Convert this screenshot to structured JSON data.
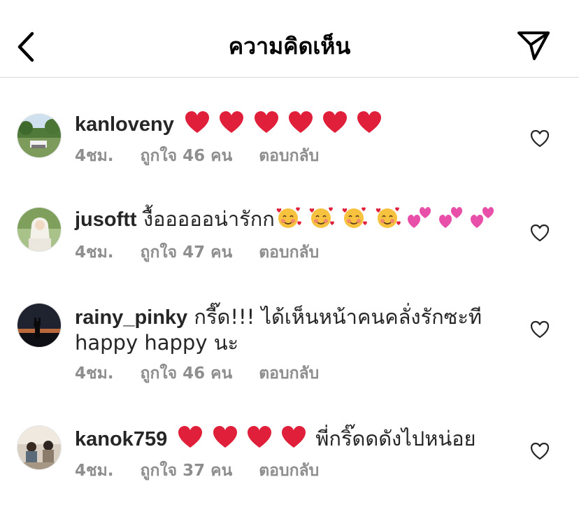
{
  "header": {
    "title": "ความคิดเห็น"
  },
  "icons": {
    "back": "chevron-left-icon",
    "send": "paper-plane-icon",
    "like": "heart-outline-icon"
  },
  "colors": {
    "heart_red": "#e0203a",
    "pink_heart": "#e84fa8",
    "muted": "#8e8e8e"
  },
  "comments": [
    {
      "username": "kanloveny",
      "text": "",
      "emoji": "❤️❤️❤️❤️❤️❤️",
      "time": "4ชม.",
      "likes": "ถูกใจ 46 คน",
      "reply": "ตอบกลับ"
    },
    {
      "username": "jusoftt",
      "text": "งื้อออออน่ารักก",
      "emoji": "🥰🥰🥰🥰💕💕💕",
      "time": "4ชม.",
      "likes": "ถูกใจ 47 คน",
      "reply": "ตอบกลับ"
    },
    {
      "username": "rainy_pinky",
      "text": "กรี๊ด!!! ได้เห็นหน้าคนคลั่งรักซะที",
      "text2": "happy happy นะ",
      "time": "4ชม.",
      "likes": "ถูกใจ 46 คน",
      "reply": "ตอบกลับ"
    },
    {
      "username": "kanok759",
      "text": "พี่กริ๊ดดดังไปหน่อย",
      "emoji": "❤️❤️❤️❤️",
      "time": "4ชม.",
      "likes": "ถูกใจ 37 คน",
      "reply": "ตอบกลับ"
    }
  ]
}
